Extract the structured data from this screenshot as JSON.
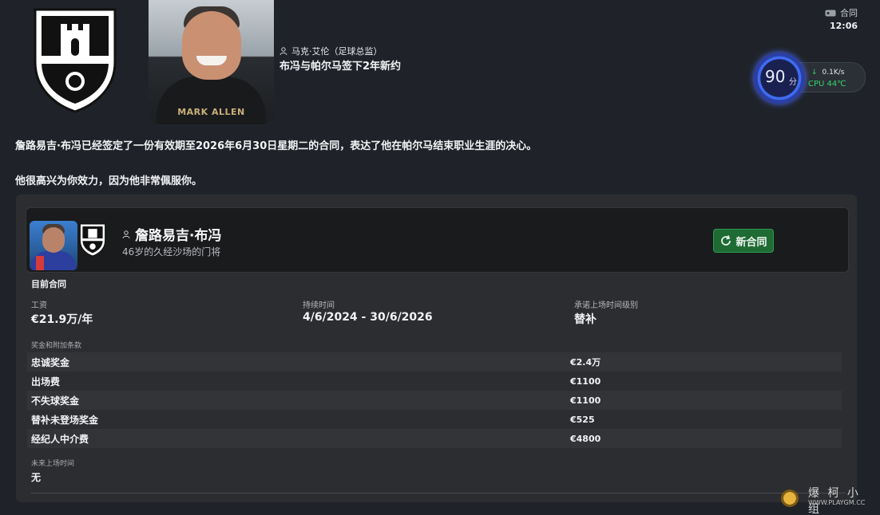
{
  "header": {
    "author": "马克·艾伦（足球总监）",
    "headline": "布冯与帕尔马签下2年新约",
    "photo_caption": "MARK ALLEN"
  },
  "top_right": {
    "label": "合同",
    "time": "12:06"
  },
  "perf_widget": {
    "score": "90",
    "score_unit": "分",
    "net_speed": "0.1K/s",
    "cpu": "CPU 44℃"
  },
  "body": {
    "para1": "詹路易吉·布冯已经签定了一份有效期至2026年6月30日星期二的合同，表达了他在帕尔马结束职业生涯的决心。",
    "para2": "他很高兴为你效力，因为他非常佩服你。"
  },
  "player": {
    "name": "詹路易吉·布冯",
    "description": "46岁的久经沙场的门将",
    "new_contract_label": "新合同"
  },
  "contract": {
    "section_title": "目前合同",
    "wage_label": "工资",
    "wage_value": "€21.9万/年",
    "duration_label": "持续时间",
    "duration_value": "4/6/2024 - 30/6/2026",
    "role_label": "承诺上场时间级别",
    "role_value": "替补",
    "bonus_title": "奖金和附加条款",
    "bonuses": [
      {
        "name": "忠诚奖金",
        "value": "€2.4万"
      },
      {
        "name": "出场费",
        "value": "€1100"
      },
      {
        "name": "不失球奖金",
        "value": "€1100"
      },
      {
        "name": "替补未登场奖金",
        "value": "€525"
      },
      {
        "name": "经纪人中介费",
        "value": "€4800"
      }
    ],
    "future_title": "未来上场时间",
    "future_value": "无"
  },
  "watermark": {
    "cn": "爆 柯 小 组",
    "url": "WWW.PLAYGM.CC"
  },
  "colors": {
    "background": "#1f2329",
    "card": "#2c2d30",
    "button_green": "#1e6b34",
    "cpu_green": "#35d46a",
    "ring_blue": "#3f6cf0"
  }
}
